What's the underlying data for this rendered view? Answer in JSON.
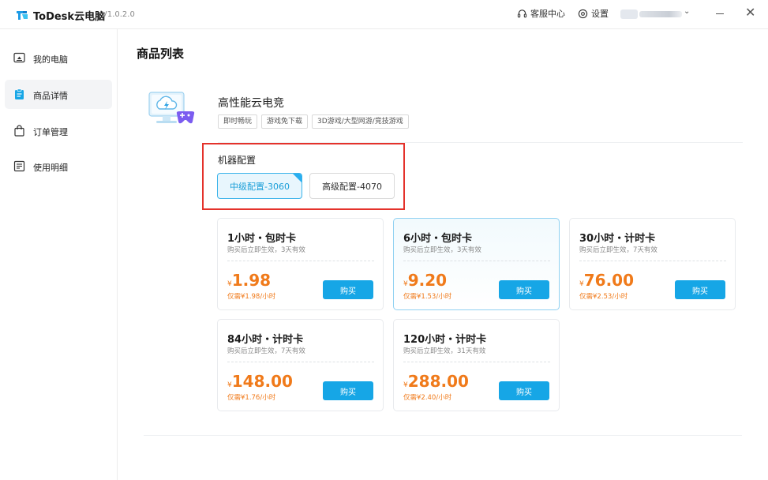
{
  "app": {
    "title": "ToDesk云电脑",
    "version": "V1.0.2.0",
    "logo_icon": "todesk-logo-icon"
  },
  "titlebar": {
    "support_label": "客服中心",
    "settings_label": "设置",
    "support_icon": "headset-icon",
    "settings_icon": "gear-icon",
    "user_dropdown_icon": "chevron-down-icon",
    "minimize_icon": "minimize-icon",
    "close_icon": "close-icon"
  },
  "sidebar": {
    "items": [
      {
        "label": "我的电脑",
        "icon": "monitor-icon",
        "active": false
      },
      {
        "label": "商品详情",
        "icon": "clipboard-icon",
        "active": true
      },
      {
        "label": "订单管理",
        "icon": "shopping-bag-icon",
        "active": false
      },
      {
        "label": "使用明细",
        "icon": "list-doc-icon",
        "active": false
      }
    ]
  },
  "main": {
    "page_title": "商品列表",
    "product": {
      "name": "高性能云电竞",
      "icon": "cloud-gaming-monitor-icon",
      "tags": [
        "即时畅玩",
        "游戏免下载",
        "3D游戏/大型网游/竞技游戏"
      ]
    },
    "config": {
      "title": "机器配置",
      "options": [
        {
          "label": "中级配置-3060",
          "selected": true
        },
        {
          "label": "高级配置-4070",
          "selected": false
        }
      ]
    },
    "cards": [
      {
        "title": "1小时・包时卡",
        "desc": "购买后立即生效，3天有效",
        "currency": "¥",
        "price": "1.98",
        "unit": "仅需¥1.98/小时",
        "buy": "购买",
        "highlight": false
      },
      {
        "title": "6小时・包时卡",
        "desc": "购买后立即生效，3天有效",
        "currency": "¥",
        "price": "9.20",
        "unit": "仅需¥1.53/小时",
        "buy": "购买",
        "highlight": true
      },
      {
        "title": "30小时・计时卡",
        "desc": "购买后立即生效，7天有效",
        "currency": "¥",
        "price": "76.00",
        "unit": "仅需¥2.53/小时",
        "buy": "购买",
        "highlight": false
      },
      {
        "title": "84小时・计时卡",
        "desc": "购买后立即生效，7天有效",
        "currency": "¥",
        "price": "148.00",
        "unit": "仅需¥1.76/小时",
        "buy": "购买",
        "highlight": false
      },
      {
        "title": "120小时・计时卡",
        "desc": "购买后立即生效，31天有效",
        "currency": "¥",
        "price": "288.00",
        "unit": "仅需¥2.40/小时",
        "buy": "购买",
        "highlight": false
      }
    ]
  },
  "colors": {
    "accent": "#16a6e6",
    "price": "#f07a1a",
    "highlight_box": "#e4322b"
  }
}
